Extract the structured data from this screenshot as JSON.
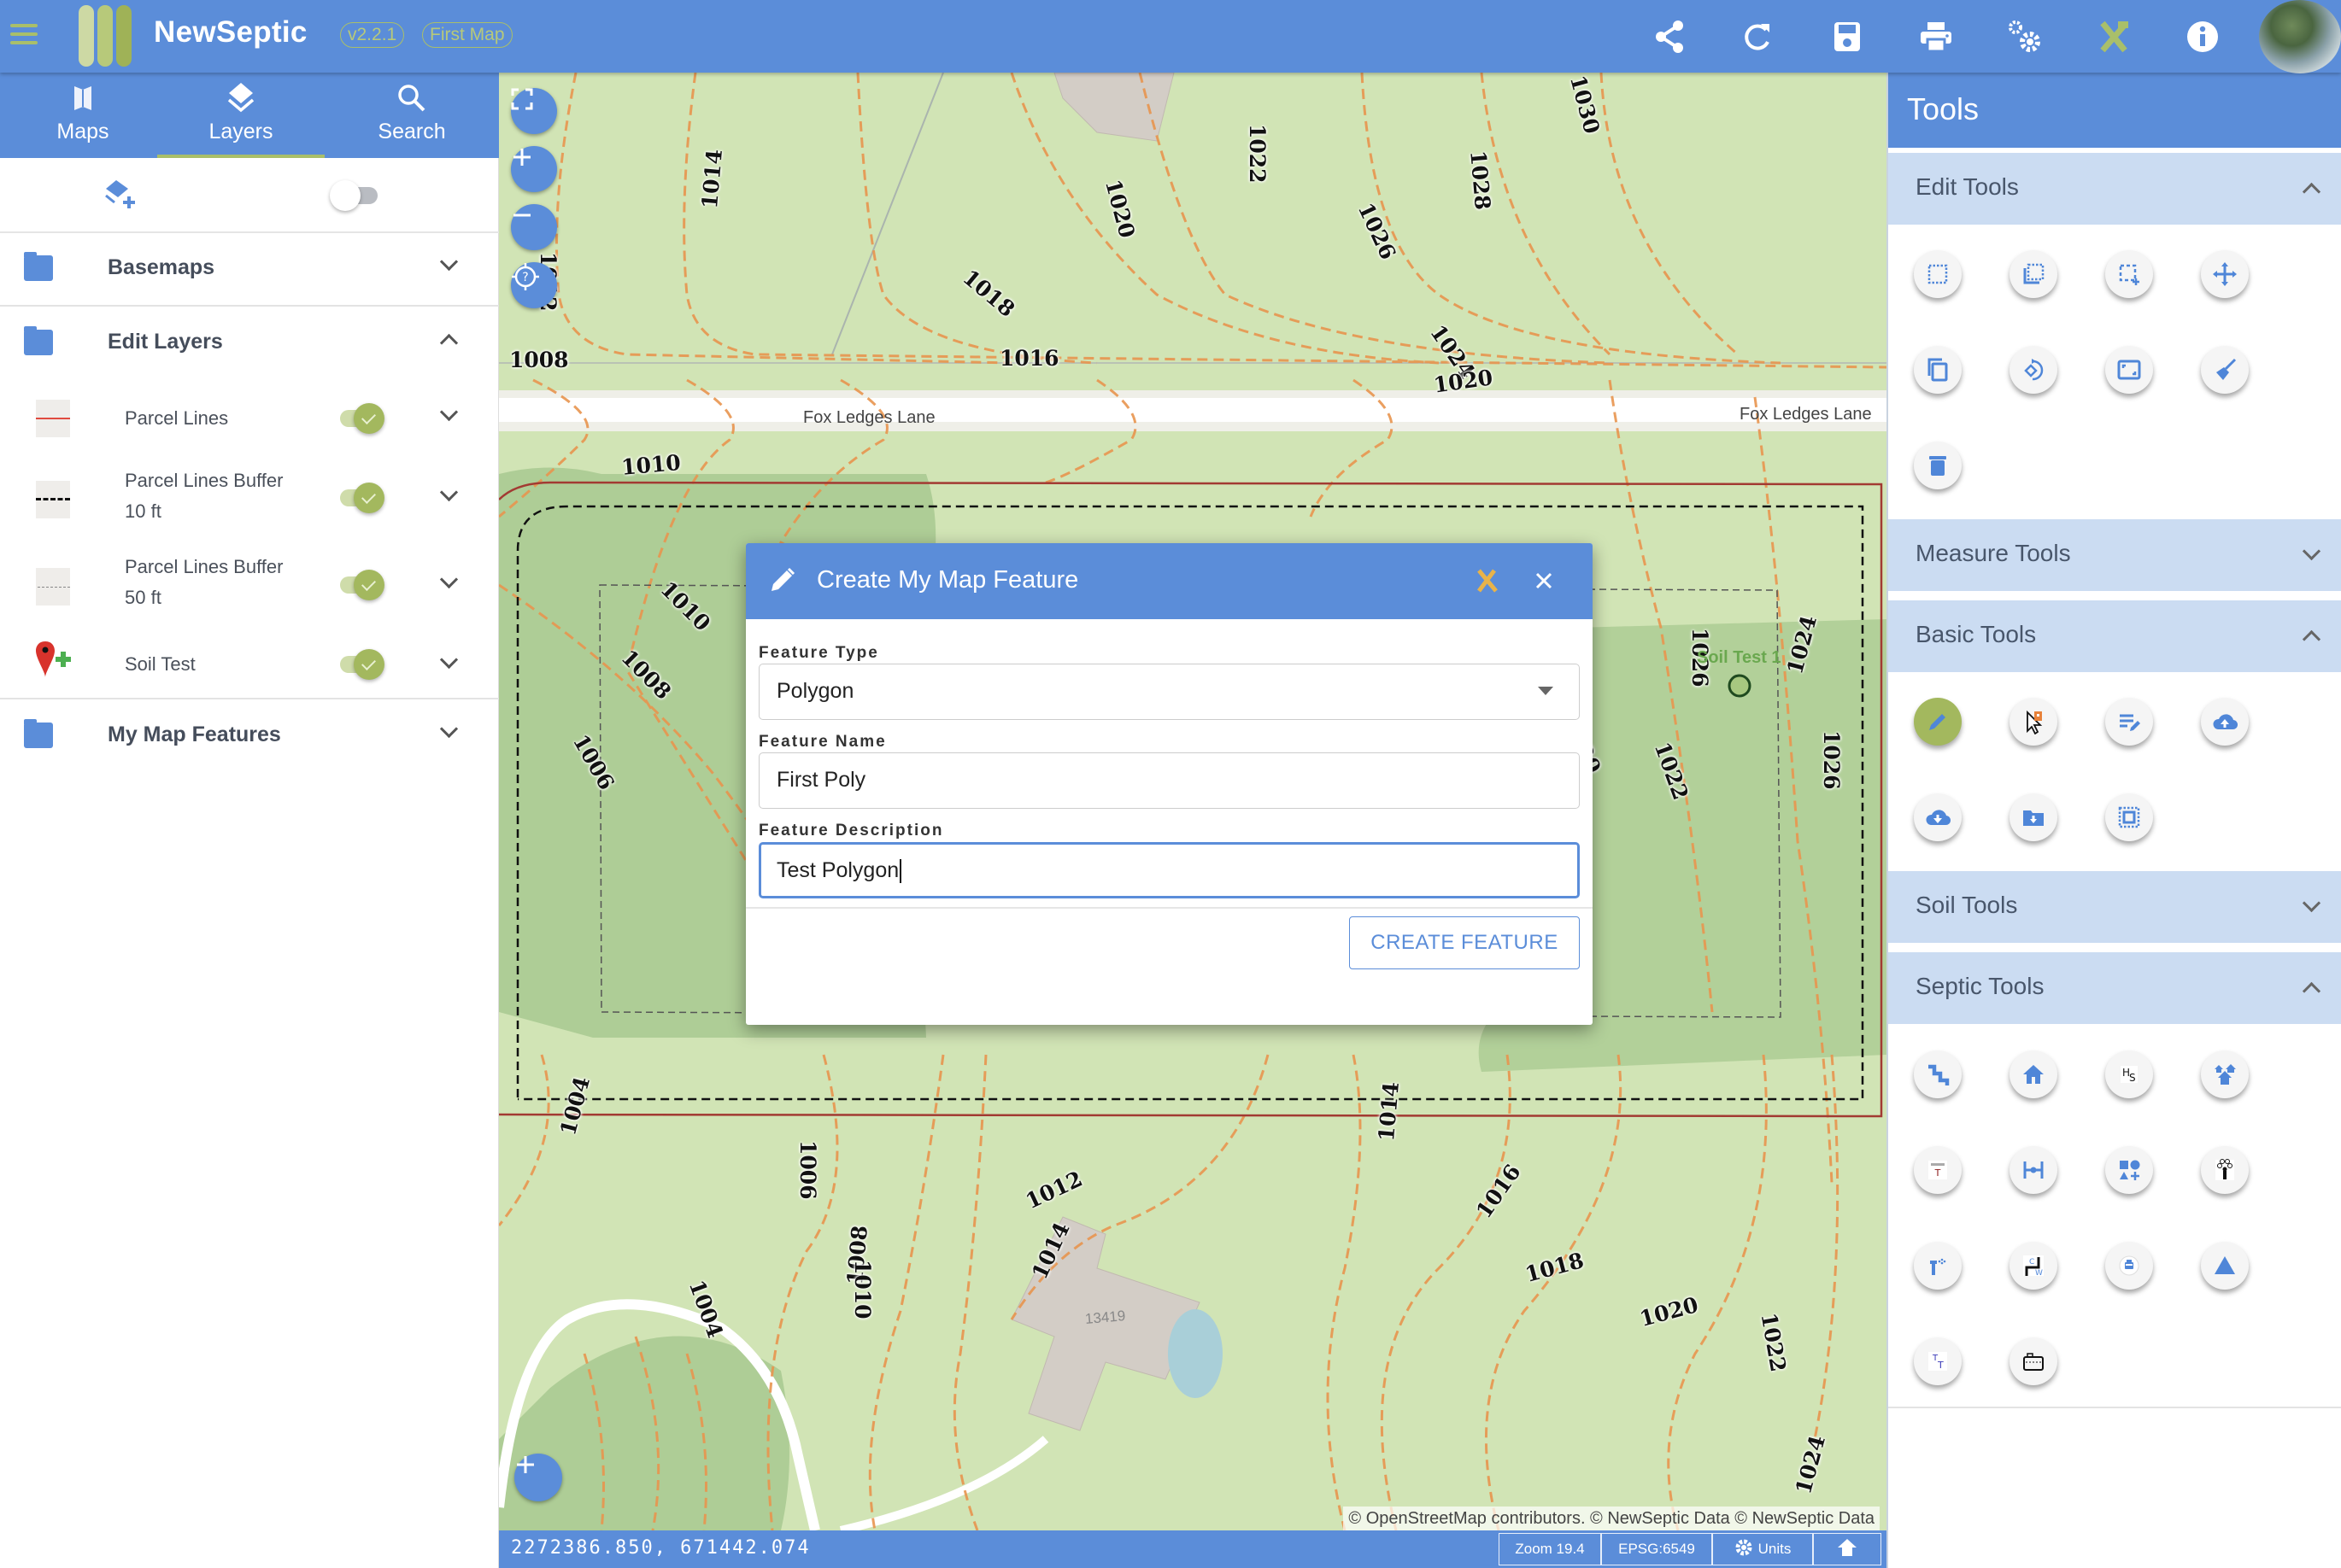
{
  "header": {
    "app_name": "NewSeptic",
    "version": "v2.2.1",
    "map_name": "First Map",
    "icons": [
      "share-icon",
      "refresh-icon",
      "save-icon",
      "print-icon",
      "settings-icon",
      "tools-icon",
      "info-icon"
    ],
    "brand_color": "#5b8dd9",
    "accent_color": "#a3b85e"
  },
  "sidebar": {
    "tabs": [
      {
        "label": "Maps",
        "icon": "map-icon",
        "active": false
      },
      {
        "label": "Layers",
        "icon": "layers-icon",
        "active": true
      },
      {
        "label": "Search",
        "icon": "search-icon",
        "active": false
      }
    ],
    "layer_toolbar": {
      "add_layer_icon": "add-layer-icon",
      "toggle_on": false
    },
    "groups": [
      {
        "name": "Basemaps",
        "expanded": false
      },
      {
        "name": "Edit Layers",
        "expanded": true,
        "layers": [
          {
            "name": "Parcel Lines",
            "line1": "Parcel Lines",
            "line2": "",
            "visible": true,
            "swatch": "solid-red-line"
          },
          {
            "name": "Parcel Lines Buffer 10 ft",
            "line1": "Parcel Lines Buffer",
            "line2": "10 ft",
            "visible": true,
            "swatch": "dashed-black-line"
          },
          {
            "name": "Parcel Lines Buffer 50 ft",
            "line1": "Parcel Lines Buffer",
            "line2": "50 ft",
            "visible": true,
            "swatch": "dashed-gray-line"
          },
          {
            "name": "Soil Test",
            "line1": "Soil Test",
            "line2": "",
            "visible": true,
            "swatch": "red-pin-plus"
          }
        ]
      },
      {
        "name": "My Map Features",
        "expanded": false
      }
    ]
  },
  "map": {
    "controls": [
      "fullscreen",
      "zoom-in",
      "zoom-out",
      "locate"
    ],
    "road_label": "Fox Ledges Lane",
    "house_number": "13419",
    "soil_test_label": "Soil Test 1",
    "contour_labels": [
      "1008",
      "1010",
      "1012",
      "1014",
      "1016",
      "1018",
      "1020",
      "1022",
      "1024",
      "1026",
      "1028",
      "1030",
      "1004",
      "1006"
    ],
    "attribution": "© OpenStreetMap contributors. © NewSeptic Data © NewSeptic Data"
  },
  "statusbar": {
    "coords": "2272386.850, 671442.074",
    "zoom": "Zoom 19.4",
    "epsg": "EPSG:6549",
    "units": "Units"
  },
  "dialog": {
    "title": "Create My Map Feature",
    "feature_type_label": "Feature Type",
    "feature_type_value": "Polygon",
    "feature_name_label": "Feature Name",
    "feature_name_value": "First Poly",
    "feature_description_label": "Feature Description",
    "feature_description_value": "Test Polygon",
    "create_button": "CREATE FEATURE"
  },
  "tools": {
    "title": "Tools",
    "sections": [
      {
        "name": "Edit Tools",
        "expanded": true,
        "tools": [
          "select-box",
          "select-corner",
          "add-selection",
          "move",
          "copy",
          "rotate",
          "resize",
          "clear",
          "delete"
        ]
      },
      {
        "name": "Measure Tools",
        "expanded": false,
        "tools": []
      },
      {
        "name": "Basic Tools",
        "expanded": true,
        "tools": [
          "draw-feature",
          "point-marker",
          "edit-text",
          "upload-cloud",
          "download-cloud",
          "download-folder",
          "select-area"
        ],
        "active": "draw-feature"
      },
      {
        "name": "Soil Tools",
        "expanded": false,
        "tools": []
      },
      {
        "name": "Septic Tools",
        "expanded": true,
        "tools": [
          "pipe",
          "house",
          "hs-label",
          "houses",
          "t-label",
          "dimension",
          "shapes-add",
          "person-abcd",
          "sprinkler",
          "cw-pipe",
          "pump-chamber",
          "triangle",
          "tt-label",
          "tank"
        ]
      }
    ]
  }
}
